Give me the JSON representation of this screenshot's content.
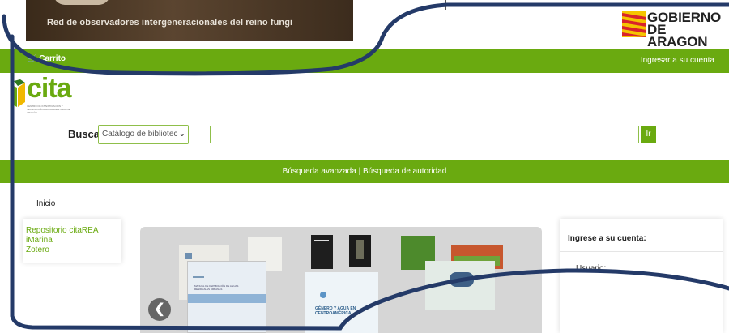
{
  "banner": {
    "caption": "Red de observadores intergeneracionales del reino fungi"
  },
  "gov_logo": {
    "line1": "GOBIERNO",
    "line2": "DE ARAGON",
    "flag_colors": [
      "#f5c400",
      "#d8242b"
    ]
  },
  "topbar": {
    "cart_label": "Carrito",
    "cart_icon": "cart-icon",
    "login_label": "Ingresar a su cuenta"
  },
  "brand": {
    "logo_text": "cita",
    "logo_subtext": "CENTRO DE INVESTIGACIÓN Y TECNOLOGÍA AGROALIMENTARIA DE ARAGÓN",
    "accent_color": "#6aaa10"
  },
  "search": {
    "label": "Buscar",
    "select_value": "Catálogo de bibliotec",
    "input_value": "",
    "go_label": "Ir"
  },
  "nav": {
    "advanced": "Búsqueda avanzada",
    "separator": " | ",
    "authority": "Búsqueda de autoridad"
  },
  "breadcrumb": {
    "home": "Inicio"
  },
  "quick_links": [
    "Repositorio citaREA",
    "iMarina",
    "Zotero"
  ],
  "carousel": {
    "prev_label": "❮",
    "books": [
      {
        "title": "MANUAL DE DEPURACIÓN DE AGUAS RESIDUALES URBANAS"
      },
      {
        "title": "GÉNERO Y AGUA EN CENTROAMÉRICA"
      }
    ]
  },
  "login_panel": {
    "title": "Ingrese a su cuenta:",
    "user_label": "Usuario:"
  }
}
